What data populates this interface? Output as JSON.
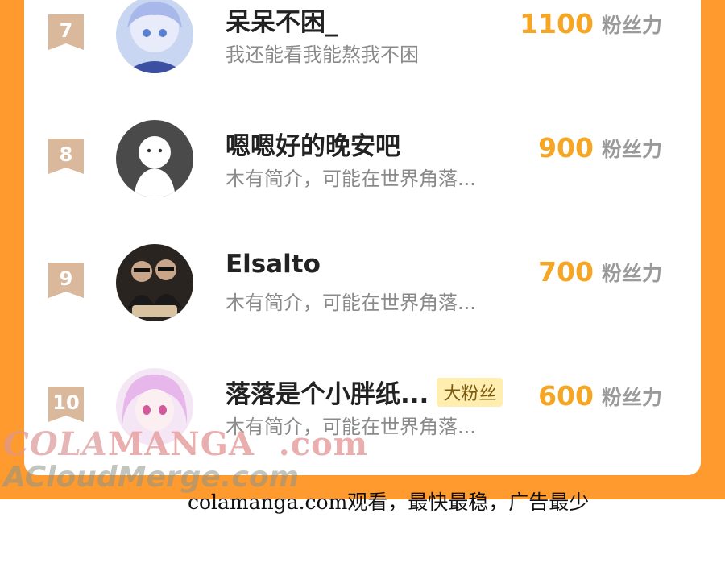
{
  "rows": [
    {
      "rank": "7",
      "name": "呆呆不困_",
      "bio": "我还能看我能熬我不困",
      "fans": "1100",
      "unit": "粉丝力",
      "badge": ""
    },
    {
      "rank": "8",
      "name": "嗯嗯好的晚安吧",
      "bio": "木有简介，可能在世界角落...",
      "fans": "900",
      "unit": "粉丝力",
      "badge": ""
    },
    {
      "rank": "9",
      "name": "Elsalto",
      "bio": "木有简介，可能在世界角落...",
      "fans": "700",
      "unit": "粉丝力",
      "badge": ""
    },
    {
      "rank": "10",
      "name": "落落是个小胖纸...",
      "bio": "木有简介，可能在世界角落...",
      "fans": "600",
      "unit": "粉丝力",
      "badge": "大粉丝"
    }
  ],
  "watermark": {
    "line1_a": "COLA",
    "line1_b": "MANGA",
    "line1_c": ".com",
    "line2": "ACloudMerge.com"
  },
  "footer": "colamanga.com观看，最快最稳，广告最少",
  "colors": {
    "frame": "#ff9a2e",
    "fans": "#f6a623",
    "rank_badge": "#d9b89c"
  }
}
